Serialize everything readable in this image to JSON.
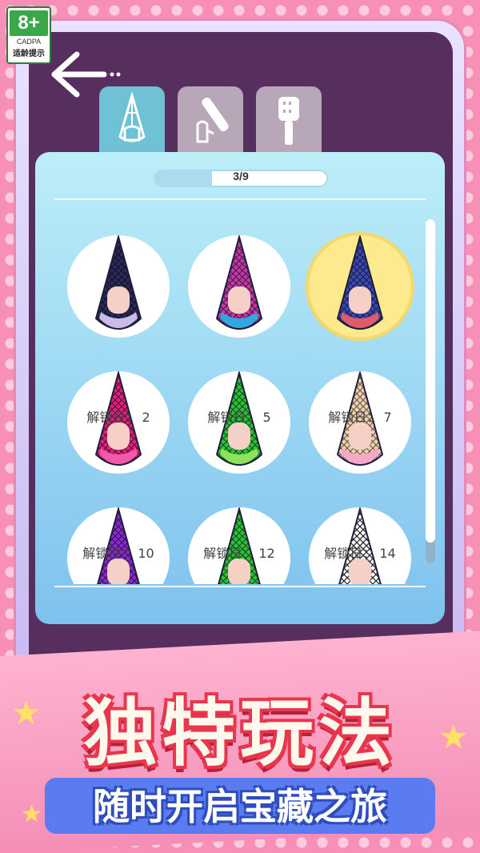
{
  "age_rating": {
    "age": "8+",
    "org": "CADPA",
    "tip": "适龄提示"
  },
  "header": {
    "back_icon": "back-arrow-icon"
  },
  "tabs": [
    {
      "name": "tab-nail-shape",
      "icon": "nail-shape-icon",
      "active": true
    },
    {
      "name": "tab-nail-file",
      "icon": "nail-file-icon",
      "active": false
    },
    {
      "name": "tab-nail-brush",
      "icon": "nail-brush-icon",
      "active": false
    }
  ],
  "progress": {
    "label": "3/9",
    "fraction": 0.333
  },
  "designs": [
    {
      "id": "design-1",
      "lock_text": "",
      "colors": [
        "#2b2a5a",
        "#c9bde8"
      ],
      "selected": false
    },
    {
      "id": "design-2",
      "lock_text": "",
      "colors": [
        "#c03aa8",
        "#2fa8e0"
      ],
      "selected": false
    },
    {
      "id": "design-3",
      "lock_text": "",
      "colors": [
        "#3a4ab0",
        "#e05a6a"
      ],
      "selected": true
    },
    {
      "id": "design-4",
      "lock_text": "解锁日： 2",
      "colors": [
        "#e0227e",
        "#f05aa8"
      ],
      "selected": false
    },
    {
      "id": "design-5",
      "lock_text": "解锁日： 5",
      "colors": [
        "#2dc23a",
        "#8fe05a"
      ],
      "selected": false
    },
    {
      "id": "design-6",
      "lock_text": "解锁日： 7",
      "colors": [
        "#f2d2b0",
        "#f5a8c8"
      ],
      "selected": false
    },
    {
      "id": "design-7",
      "lock_text": "解锁日： 10",
      "colors": [
        "#8a2ad0",
        "#b86ae8"
      ],
      "selected": false
    },
    {
      "id": "design-8",
      "lock_text": "解锁日： 12",
      "colors": [
        "#2dc23a",
        "#b0e060"
      ],
      "selected": false
    },
    {
      "id": "design-9",
      "lock_text": "解锁日： 14",
      "colors": [
        "#ffffff",
        "#222222"
      ],
      "selected": false
    }
  ],
  "banner": {
    "title": "独特玩法",
    "subtitle": "随时开启宝藏之旅"
  }
}
